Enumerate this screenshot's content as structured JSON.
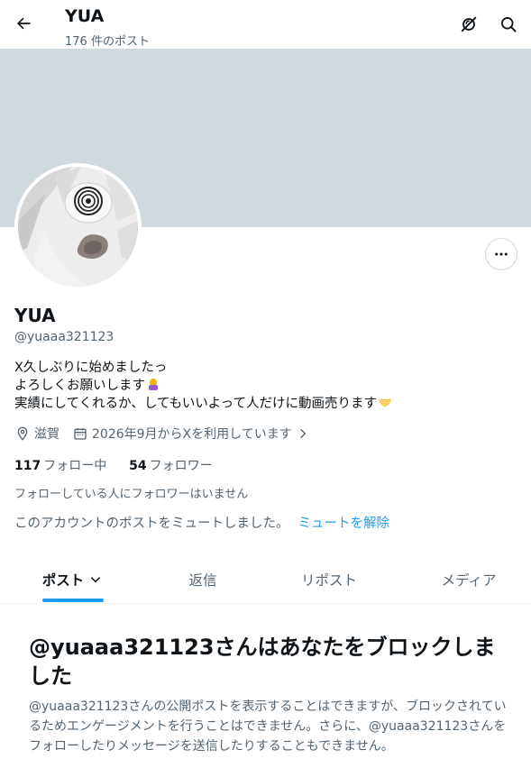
{
  "header": {
    "title": "YUA",
    "post_count": "176 件のポスト",
    "back_icon": "arrow-left-icon",
    "notify_icon": "bell-off-icon",
    "search_icon": "search-icon"
  },
  "colors": {
    "banner": "#cfd9de",
    "accent": "#1d9bf0",
    "secondary_text": "#536471",
    "primary_text": "#0f1419"
  },
  "profile": {
    "name": "YUA",
    "handle": "@yuaaa321123",
    "bio_line1": "X久しぶりに始めましたっ",
    "bio_line2": "よろしくお願いします",
    "bio_line3": "実績にしてくれるか、してもいいよって人だけに動画売ります",
    "location": "滋賀",
    "joined": "2026年9月からXを利用しています",
    "following_count": "117",
    "following_label": "フォロー中",
    "followers_count": "54",
    "followers_label": "フォロワー",
    "no_mutual_followers": "フォローしている人にフォロワーはいません",
    "muted_text": "このアカウントのポストをミュートしました。",
    "unmute_link": "ミュートを解除"
  },
  "tabs": [
    {
      "label": "ポスト",
      "active": true
    },
    {
      "label": "返信",
      "active": false
    },
    {
      "label": "リポスト",
      "active": false
    },
    {
      "label": "メディア",
      "active": false
    }
  ],
  "blocked": {
    "title": "@yuaaa321123さんはあなたをブロックしました",
    "description": "@yuaaa321123さんの公開ポストを表示することはできますが、ブロックされているためエンゲージメントを行うことはできません。さらに、@yuaaa321123さんをフォローしたりメッセージを送信したりすることもできません。"
  }
}
